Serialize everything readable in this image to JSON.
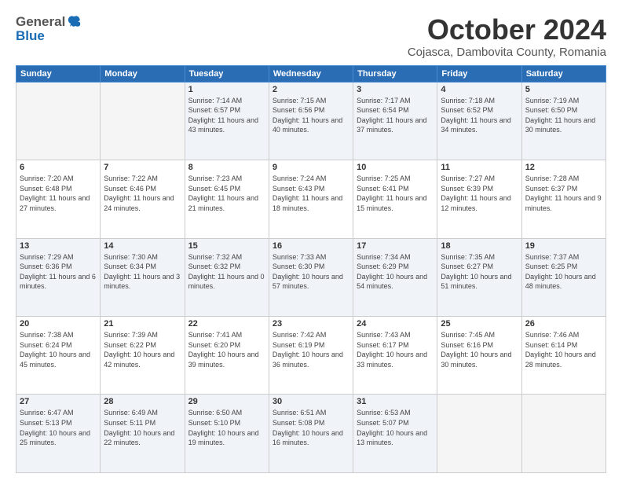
{
  "header": {
    "logo_general": "General",
    "logo_blue": "Blue",
    "month_title": "October 2024",
    "subtitle": "Cojasca, Dambovita County, Romania"
  },
  "weekdays": [
    "Sunday",
    "Monday",
    "Tuesday",
    "Wednesday",
    "Thursday",
    "Friday",
    "Saturday"
  ],
  "rows": [
    [
      {
        "day": "",
        "sunrise": "",
        "sunset": "",
        "daylight": ""
      },
      {
        "day": "",
        "sunrise": "",
        "sunset": "",
        "daylight": ""
      },
      {
        "day": "1",
        "sunrise": "Sunrise: 7:14 AM",
        "sunset": "Sunset: 6:57 PM",
        "daylight": "Daylight: 11 hours and 43 minutes."
      },
      {
        "day": "2",
        "sunrise": "Sunrise: 7:15 AM",
        "sunset": "Sunset: 6:56 PM",
        "daylight": "Daylight: 11 hours and 40 minutes."
      },
      {
        "day": "3",
        "sunrise": "Sunrise: 7:17 AM",
        "sunset": "Sunset: 6:54 PM",
        "daylight": "Daylight: 11 hours and 37 minutes."
      },
      {
        "day": "4",
        "sunrise": "Sunrise: 7:18 AM",
        "sunset": "Sunset: 6:52 PM",
        "daylight": "Daylight: 11 hours and 34 minutes."
      },
      {
        "day": "5",
        "sunrise": "Sunrise: 7:19 AM",
        "sunset": "Sunset: 6:50 PM",
        "daylight": "Daylight: 11 hours and 30 minutes."
      }
    ],
    [
      {
        "day": "6",
        "sunrise": "Sunrise: 7:20 AM",
        "sunset": "Sunset: 6:48 PM",
        "daylight": "Daylight: 11 hours and 27 minutes."
      },
      {
        "day": "7",
        "sunrise": "Sunrise: 7:22 AM",
        "sunset": "Sunset: 6:46 PM",
        "daylight": "Daylight: 11 hours and 24 minutes."
      },
      {
        "day": "8",
        "sunrise": "Sunrise: 7:23 AM",
        "sunset": "Sunset: 6:45 PM",
        "daylight": "Daylight: 11 hours and 21 minutes."
      },
      {
        "day": "9",
        "sunrise": "Sunrise: 7:24 AM",
        "sunset": "Sunset: 6:43 PM",
        "daylight": "Daylight: 11 hours and 18 minutes."
      },
      {
        "day": "10",
        "sunrise": "Sunrise: 7:25 AM",
        "sunset": "Sunset: 6:41 PM",
        "daylight": "Daylight: 11 hours and 15 minutes."
      },
      {
        "day": "11",
        "sunrise": "Sunrise: 7:27 AM",
        "sunset": "Sunset: 6:39 PM",
        "daylight": "Daylight: 11 hours and 12 minutes."
      },
      {
        "day": "12",
        "sunrise": "Sunrise: 7:28 AM",
        "sunset": "Sunset: 6:37 PM",
        "daylight": "Daylight: 11 hours and 9 minutes."
      }
    ],
    [
      {
        "day": "13",
        "sunrise": "Sunrise: 7:29 AM",
        "sunset": "Sunset: 6:36 PM",
        "daylight": "Daylight: 11 hours and 6 minutes."
      },
      {
        "day": "14",
        "sunrise": "Sunrise: 7:30 AM",
        "sunset": "Sunset: 6:34 PM",
        "daylight": "Daylight: 11 hours and 3 minutes."
      },
      {
        "day": "15",
        "sunrise": "Sunrise: 7:32 AM",
        "sunset": "Sunset: 6:32 PM",
        "daylight": "Daylight: 11 hours and 0 minutes."
      },
      {
        "day": "16",
        "sunrise": "Sunrise: 7:33 AM",
        "sunset": "Sunset: 6:30 PM",
        "daylight": "Daylight: 10 hours and 57 minutes."
      },
      {
        "day": "17",
        "sunrise": "Sunrise: 7:34 AM",
        "sunset": "Sunset: 6:29 PM",
        "daylight": "Daylight: 10 hours and 54 minutes."
      },
      {
        "day": "18",
        "sunrise": "Sunrise: 7:35 AM",
        "sunset": "Sunset: 6:27 PM",
        "daylight": "Daylight: 10 hours and 51 minutes."
      },
      {
        "day": "19",
        "sunrise": "Sunrise: 7:37 AM",
        "sunset": "Sunset: 6:25 PM",
        "daylight": "Daylight: 10 hours and 48 minutes."
      }
    ],
    [
      {
        "day": "20",
        "sunrise": "Sunrise: 7:38 AM",
        "sunset": "Sunset: 6:24 PM",
        "daylight": "Daylight: 10 hours and 45 minutes."
      },
      {
        "day": "21",
        "sunrise": "Sunrise: 7:39 AM",
        "sunset": "Sunset: 6:22 PM",
        "daylight": "Daylight: 10 hours and 42 minutes."
      },
      {
        "day": "22",
        "sunrise": "Sunrise: 7:41 AM",
        "sunset": "Sunset: 6:20 PM",
        "daylight": "Daylight: 10 hours and 39 minutes."
      },
      {
        "day": "23",
        "sunrise": "Sunrise: 7:42 AM",
        "sunset": "Sunset: 6:19 PM",
        "daylight": "Daylight: 10 hours and 36 minutes."
      },
      {
        "day": "24",
        "sunrise": "Sunrise: 7:43 AM",
        "sunset": "Sunset: 6:17 PM",
        "daylight": "Daylight: 10 hours and 33 minutes."
      },
      {
        "day": "25",
        "sunrise": "Sunrise: 7:45 AM",
        "sunset": "Sunset: 6:16 PM",
        "daylight": "Daylight: 10 hours and 30 minutes."
      },
      {
        "day": "26",
        "sunrise": "Sunrise: 7:46 AM",
        "sunset": "Sunset: 6:14 PM",
        "daylight": "Daylight: 10 hours and 28 minutes."
      }
    ],
    [
      {
        "day": "27",
        "sunrise": "Sunrise: 6:47 AM",
        "sunset": "Sunset: 5:13 PM",
        "daylight": "Daylight: 10 hours and 25 minutes."
      },
      {
        "day": "28",
        "sunrise": "Sunrise: 6:49 AM",
        "sunset": "Sunset: 5:11 PM",
        "daylight": "Daylight: 10 hours and 22 minutes."
      },
      {
        "day": "29",
        "sunrise": "Sunrise: 6:50 AM",
        "sunset": "Sunset: 5:10 PM",
        "daylight": "Daylight: 10 hours and 19 minutes."
      },
      {
        "day": "30",
        "sunrise": "Sunrise: 6:51 AM",
        "sunset": "Sunset: 5:08 PM",
        "daylight": "Daylight: 10 hours and 16 minutes."
      },
      {
        "day": "31",
        "sunrise": "Sunrise: 6:53 AM",
        "sunset": "Sunset: 5:07 PM",
        "daylight": "Daylight: 10 hours and 13 minutes."
      },
      {
        "day": "",
        "sunrise": "",
        "sunset": "",
        "daylight": ""
      },
      {
        "day": "",
        "sunrise": "",
        "sunset": "",
        "daylight": ""
      }
    ]
  ]
}
